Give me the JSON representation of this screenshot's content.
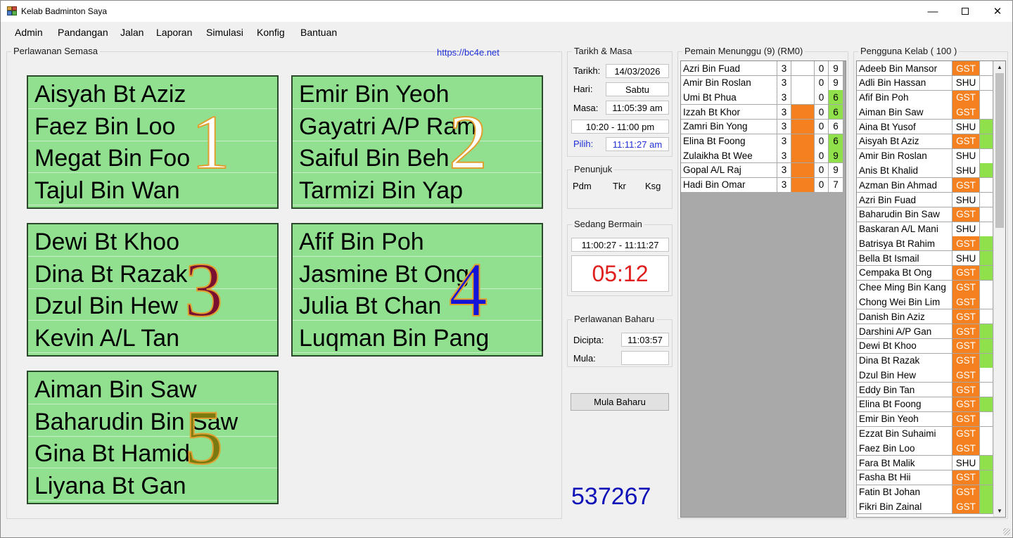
{
  "window": {
    "title": "Kelab Badminton Saya",
    "min_glyph": "—",
    "close_glyph": "✕"
  },
  "menu": [
    "Admin",
    "Pandangan",
    "Jalan",
    "Laporan",
    "Simulasi",
    "Konfig",
    "Bantuan"
  ],
  "current_matches": {
    "title": "Perlawanan Semasa",
    "link": "https://bc4e.net",
    "courts": [
      {
        "number": "1",
        "color": "#ffffff",
        "players": [
          "Aisyah Bt Aziz",
          "Faez Bin Loo",
          "Megat Bin Foo",
          "Tajul Bin Wan"
        ]
      },
      {
        "number": "2",
        "color": "#ffffff",
        "players": [
          "Emir Bin Yeoh",
          "Gayatri A/P Ram",
          "Saiful Bin Beh",
          "Tarmizi Bin Yap"
        ]
      },
      {
        "number": "3",
        "color": "#7a1030",
        "players": [
          "Dewi Bt Khoo",
          "Dina Bt Razak",
          "Dzul Bin Hew",
          "Kevin A/L Tan"
        ]
      },
      {
        "number": "4",
        "color": "#1414d8",
        "players": [
          "Afif Bin Poh",
          "Jasmine Bt Ong",
          "Julia Bt Chan",
          "Luqman Bin Pang"
        ]
      },
      {
        "number": "5",
        "color": "#7a7a10",
        "players": [
          "Aiman Bin Saw",
          "Baharudin Bin Saw",
          "Gina Bt Hamid",
          "Liyana Bt Gan"
        ]
      }
    ]
  },
  "datetime": {
    "title": "Tarikh & Masa",
    "date_label": "Tarikh:",
    "date": "14/03/2026",
    "day_label": "Hari:",
    "day": "Sabtu",
    "time_label": "Masa:",
    "time": "11:05:39 am",
    "session": "10:20 - 11:00 pm",
    "pick_label": "Pilih:",
    "pick": "11:11:27 am"
  },
  "indicator": {
    "title": "Penunjuk",
    "labels": [
      "Pdm",
      "Tkr",
      "Ksg"
    ]
  },
  "playing": {
    "title": "Sedang Bermain",
    "range": "11:00:27 - 11:11:27",
    "countdown": "05:12"
  },
  "new_match": {
    "title": "Perlawanan Baharu",
    "created_label": "Dicipta:",
    "created": "11:03:57",
    "start_label": "Mula:",
    "start": ""
  },
  "start_button": "Mula Baharu",
  "counter": "537267",
  "waiting": {
    "title": "Pemain Menunggu (9) (RM0)",
    "rows": [
      {
        "name": "Azri Bin Fuad",
        "a": "3",
        "b_color": "",
        "c": "0",
        "d": "9",
        "d_color": ""
      },
      {
        "name": "Amir Bin Roslan",
        "a": "3",
        "b_color": "",
        "c": "0",
        "d": "9",
        "d_color": ""
      },
      {
        "name": "Umi Bt Phua",
        "a": "3",
        "b_color": "",
        "c": "0",
        "d": "6",
        "d_color": "lime"
      },
      {
        "name": "Izzah Bt Khor",
        "a": "3",
        "b_color": "orange",
        "c": "0",
        "d": "6",
        "d_color": "lime"
      },
      {
        "name": "Zamri Bin Yong",
        "a": "3",
        "b_color": "orange",
        "c": "0",
        "d": "6",
        "d_color": ""
      },
      {
        "name": "Elina Bt Foong",
        "a": "3",
        "b_color": "orange",
        "c": "0",
        "d": "6",
        "d_color": "lime"
      },
      {
        "name": "Zulaikha Bt Wee",
        "a": "3",
        "b_color": "orange",
        "c": "0",
        "d": "9",
        "d_color": "lime"
      },
      {
        "name": "Gopal A/L Raj",
        "a": "3",
        "b_color": "orange",
        "c": "0",
        "d": "9",
        "d_color": ""
      },
      {
        "name": "Hadi Bin Omar",
        "a": "3",
        "b_color": "orange",
        "c": "0",
        "d": "7",
        "d_color": ""
      }
    ]
  },
  "members": {
    "title": "Pengguna Kelab ( 100 )",
    "scroll_up": "▲",
    "scroll_down": "▼",
    "rows": [
      {
        "name": "Adeeb Bin Mansor",
        "type": "GST",
        "flag": ""
      },
      {
        "name": "Adli Bin Hassan",
        "type": "SHU",
        "flag": ""
      },
      {
        "name": "Afif Bin Poh",
        "type": "GST",
        "flag": ""
      },
      {
        "name": "Aiman Bin Saw",
        "type": "GST",
        "flag": ""
      },
      {
        "name": "Aina Bt Yusof",
        "type": "SHU",
        "flag": "lime"
      },
      {
        "name": "Aisyah Bt Aziz",
        "type": "GST",
        "flag": "lime"
      },
      {
        "name": "Amir Bin Roslan",
        "type": "SHU",
        "flag": ""
      },
      {
        "name": "Anis Bt Khalid",
        "type": "SHU",
        "flag": "lime"
      },
      {
        "name": "Azman Bin Ahmad",
        "type": "GST",
        "flag": ""
      },
      {
        "name": "Azri Bin Fuad",
        "type": "SHU",
        "flag": ""
      },
      {
        "name": "Baharudin Bin Saw",
        "type": "GST",
        "flag": ""
      },
      {
        "name": "Baskaran A/L Mani",
        "type": "SHU",
        "flag": ""
      },
      {
        "name": "Batrisya Bt Rahim",
        "type": "GST",
        "flag": "lime"
      },
      {
        "name": "Bella Bt Ismail",
        "type": "SHU",
        "flag": "lime"
      },
      {
        "name": "Cempaka Bt Ong",
        "type": "GST",
        "flag": "lime"
      },
      {
        "name": "Chee Ming Bin Kang",
        "type": "GST",
        "flag": ""
      },
      {
        "name": "Chong Wei Bin Lim",
        "type": "GST",
        "flag": ""
      },
      {
        "name": "Danish Bin Aziz",
        "type": "GST",
        "flag": ""
      },
      {
        "name": "Darshini A/P Gan",
        "type": "GST",
        "flag": "lime"
      },
      {
        "name": "Dewi Bt Khoo",
        "type": "GST",
        "flag": "lime"
      },
      {
        "name": "Dina Bt Razak",
        "type": "GST",
        "flag": "lime"
      },
      {
        "name": "Dzul Bin Hew",
        "type": "GST",
        "flag": ""
      },
      {
        "name": "Eddy Bin Tan",
        "type": "GST",
        "flag": ""
      },
      {
        "name": "Elina Bt Foong",
        "type": "GST",
        "flag": "lime"
      },
      {
        "name": "Emir Bin Yeoh",
        "type": "GST",
        "flag": ""
      },
      {
        "name": "Ezzat Bin Suhaimi",
        "type": "GST",
        "flag": ""
      },
      {
        "name": "Faez Bin Loo",
        "type": "GST",
        "flag": ""
      },
      {
        "name": "Fara Bt Malik",
        "type": "SHU",
        "flag": "lime"
      },
      {
        "name": "Fasha Bt Hii",
        "type": "GST",
        "flag": "lime"
      },
      {
        "name": "Fatin Bt Johan",
        "type": "GST",
        "flag": "lime"
      },
      {
        "name": "Fikri Bin Zainal",
        "type": "GST",
        "flag": "lime"
      }
    ]
  }
}
